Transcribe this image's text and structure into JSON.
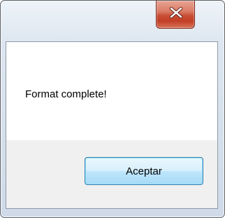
{
  "dialog": {
    "message": "Format complete!",
    "ok_label": "Aceptar",
    "close_icon": "close-icon"
  },
  "colors": {
    "close_button_red": "#c84e35",
    "ok_button_border": "#3c7fb1",
    "footer_background": "#f0f0f0"
  }
}
